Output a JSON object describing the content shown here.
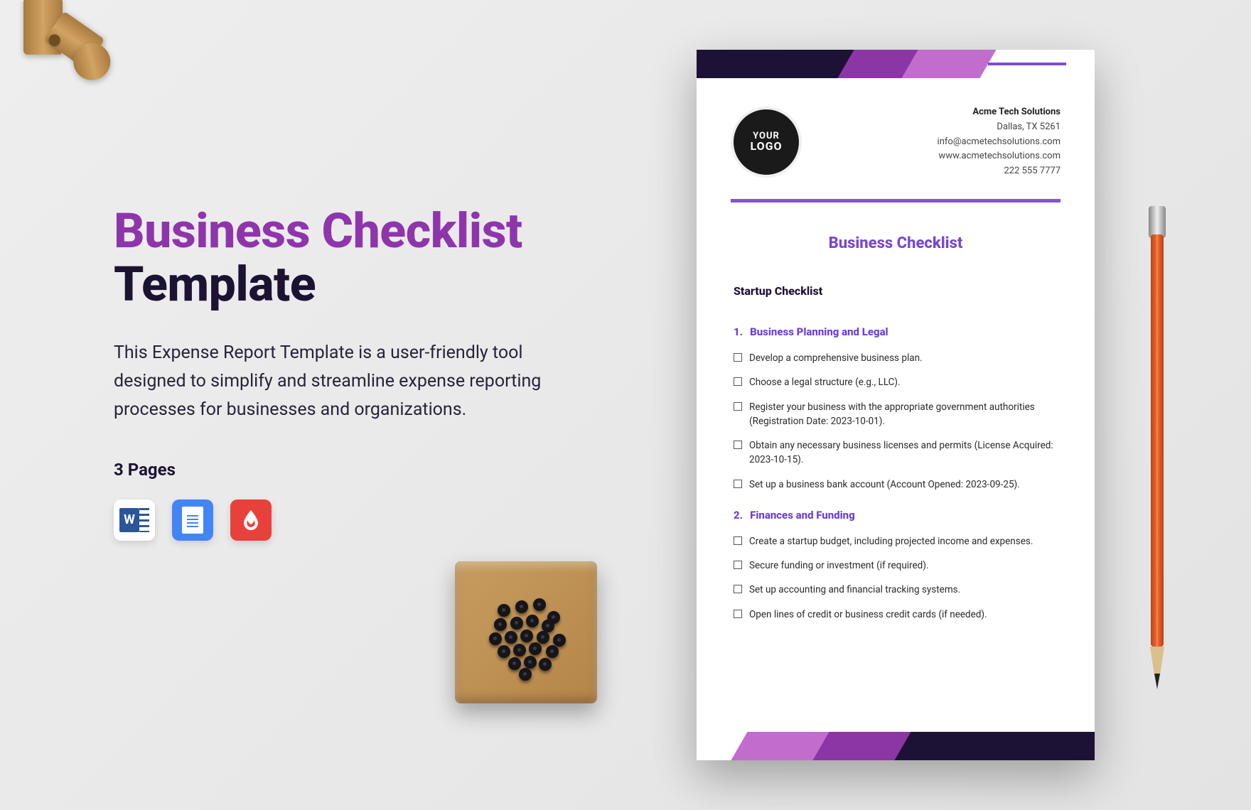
{
  "title_line1": "Business Checklist",
  "title_line2": "Template",
  "description": "This Expense Report Template is a user-friendly tool designed to simplify and streamline expense reporting processes for businesses and organizations.",
  "pages_label": "3 Pages",
  "file_icons": {
    "word": "MS Word",
    "gdoc": "Google Docs",
    "pdf": "PDF"
  },
  "doc": {
    "logo_line1": "YOUR",
    "logo_line2": "LOGO",
    "company": {
      "name": "Acme Tech Solutions",
      "city": "Dallas, TX 5261",
      "email": "info@acmetechsolutions.com",
      "web": "www.acmetechsolutions.com",
      "phone": "222 555 7777"
    },
    "title": "Business Checklist",
    "subtitle": "Startup Checklist",
    "sections": [
      {
        "num": "1.",
        "heading": "Business Planning and Legal",
        "items": [
          "Develop a comprehensive business plan.",
          "Choose a legal structure (e.g., LLC).",
          "Register your business with the appropriate government authorities (Registration Date: 2023-10-01).",
          "Obtain any necessary business licenses and permits (License Acquired: 2023-10-15).",
          "Set up a business bank account (Account Opened: 2023-09-25)."
        ]
      },
      {
        "num": "2.",
        "heading": "Finances and Funding",
        "items": [
          "Create a startup budget, including projected income and expenses.",
          "Secure funding or investment (if required).",
          "Set up accounting and financial tracking systems.",
          "Open lines of credit or business credit cards (if needed)."
        ]
      }
    ]
  }
}
